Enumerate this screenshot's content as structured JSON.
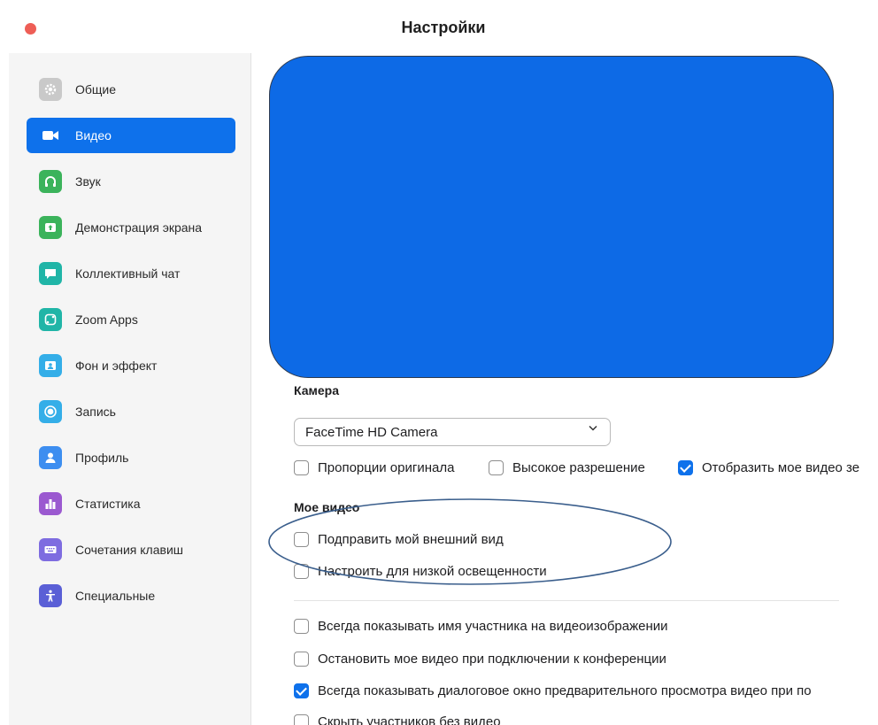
{
  "window": {
    "title": "Настройки",
    "close_color": "#ee5e56"
  },
  "sidebar": {
    "items": [
      {
        "label": "Общие",
        "icon": "gear-icon",
        "color": "#c8c8c8",
        "active": false
      },
      {
        "label": "Видео",
        "icon": "video-camera-icon",
        "color": "#0e71eb",
        "active": true
      },
      {
        "label": "Звук",
        "icon": "headphones-icon",
        "color": "#3bb35b",
        "active": false
      },
      {
        "label": "Демонстрация экрана",
        "icon": "share-screen-icon",
        "color": "#3bb35b",
        "active": false
      },
      {
        "label": "Коллективный чат",
        "icon": "chat-icon",
        "color": "#20b5a7",
        "active": false
      },
      {
        "label": "Zoom Apps",
        "icon": "apps-icon",
        "color": "#20b5a7",
        "active": false
      },
      {
        "label": "Фон и эффект",
        "icon": "background-icon",
        "color": "#34aee8",
        "active": false
      },
      {
        "label": "Запись",
        "icon": "record-icon",
        "color": "#34aee8",
        "active": false
      },
      {
        "label": "Профиль",
        "icon": "profile-icon",
        "color": "#3d8ef0",
        "active": false
      },
      {
        "label": "Статистика",
        "icon": "statistics-icon",
        "color": "#9b59d0",
        "active": false
      },
      {
        "label": "Сочетания клавиш",
        "icon": "keyboard-icon",
        "color": "#7e6ce0",
        "active": false
      },
      {
        "label": "Специальные",
        "icon": "accessibility-icon",
        "color": "#5a5fd6",
        "active": false
      }
    ]
  },
  "main": {
    "preview_color": "#0d6ae6",
    "camera": {
      "title": "Камера",
      "selected": "FaceTime HD Camera",
      "options": [
        {
          "label": "Пропорции оригинала",
          "checked": false
        },
        {
          "label": "Высокое разрешение",
          "checked": false
        },
        {
          "label": "Отобразить мое видео зе",
          "checked": true
        }
      ]
    },
    "my_video": {
      "title": "Мое видео",
      "options": [
        {
          "label": "Подправить мой внешний вид",
          "checked": false
        },
        {
          "label": "Настроить для низкой освещенности",
          "checked": false
        }
      ]
    },
    "more_options": [
      {
        "label": "Всегда показывать имя участника на видеоизображении",
        "checked": false
      },
      {
        "label": "Остановить мое видео при подключении к конференции",
        "checked": false
      },
      {
        "label": "Всегда показывать диалоговое окно предварительного просмотра видео при по",
        "checked": true
      },
      {
        "label": "Скрыть участников без видео",
        "checked": false
      }
    ]
  },
  "accent_color": "#0e71eb",
  "annotation_color": "#3a5e8c"
}
